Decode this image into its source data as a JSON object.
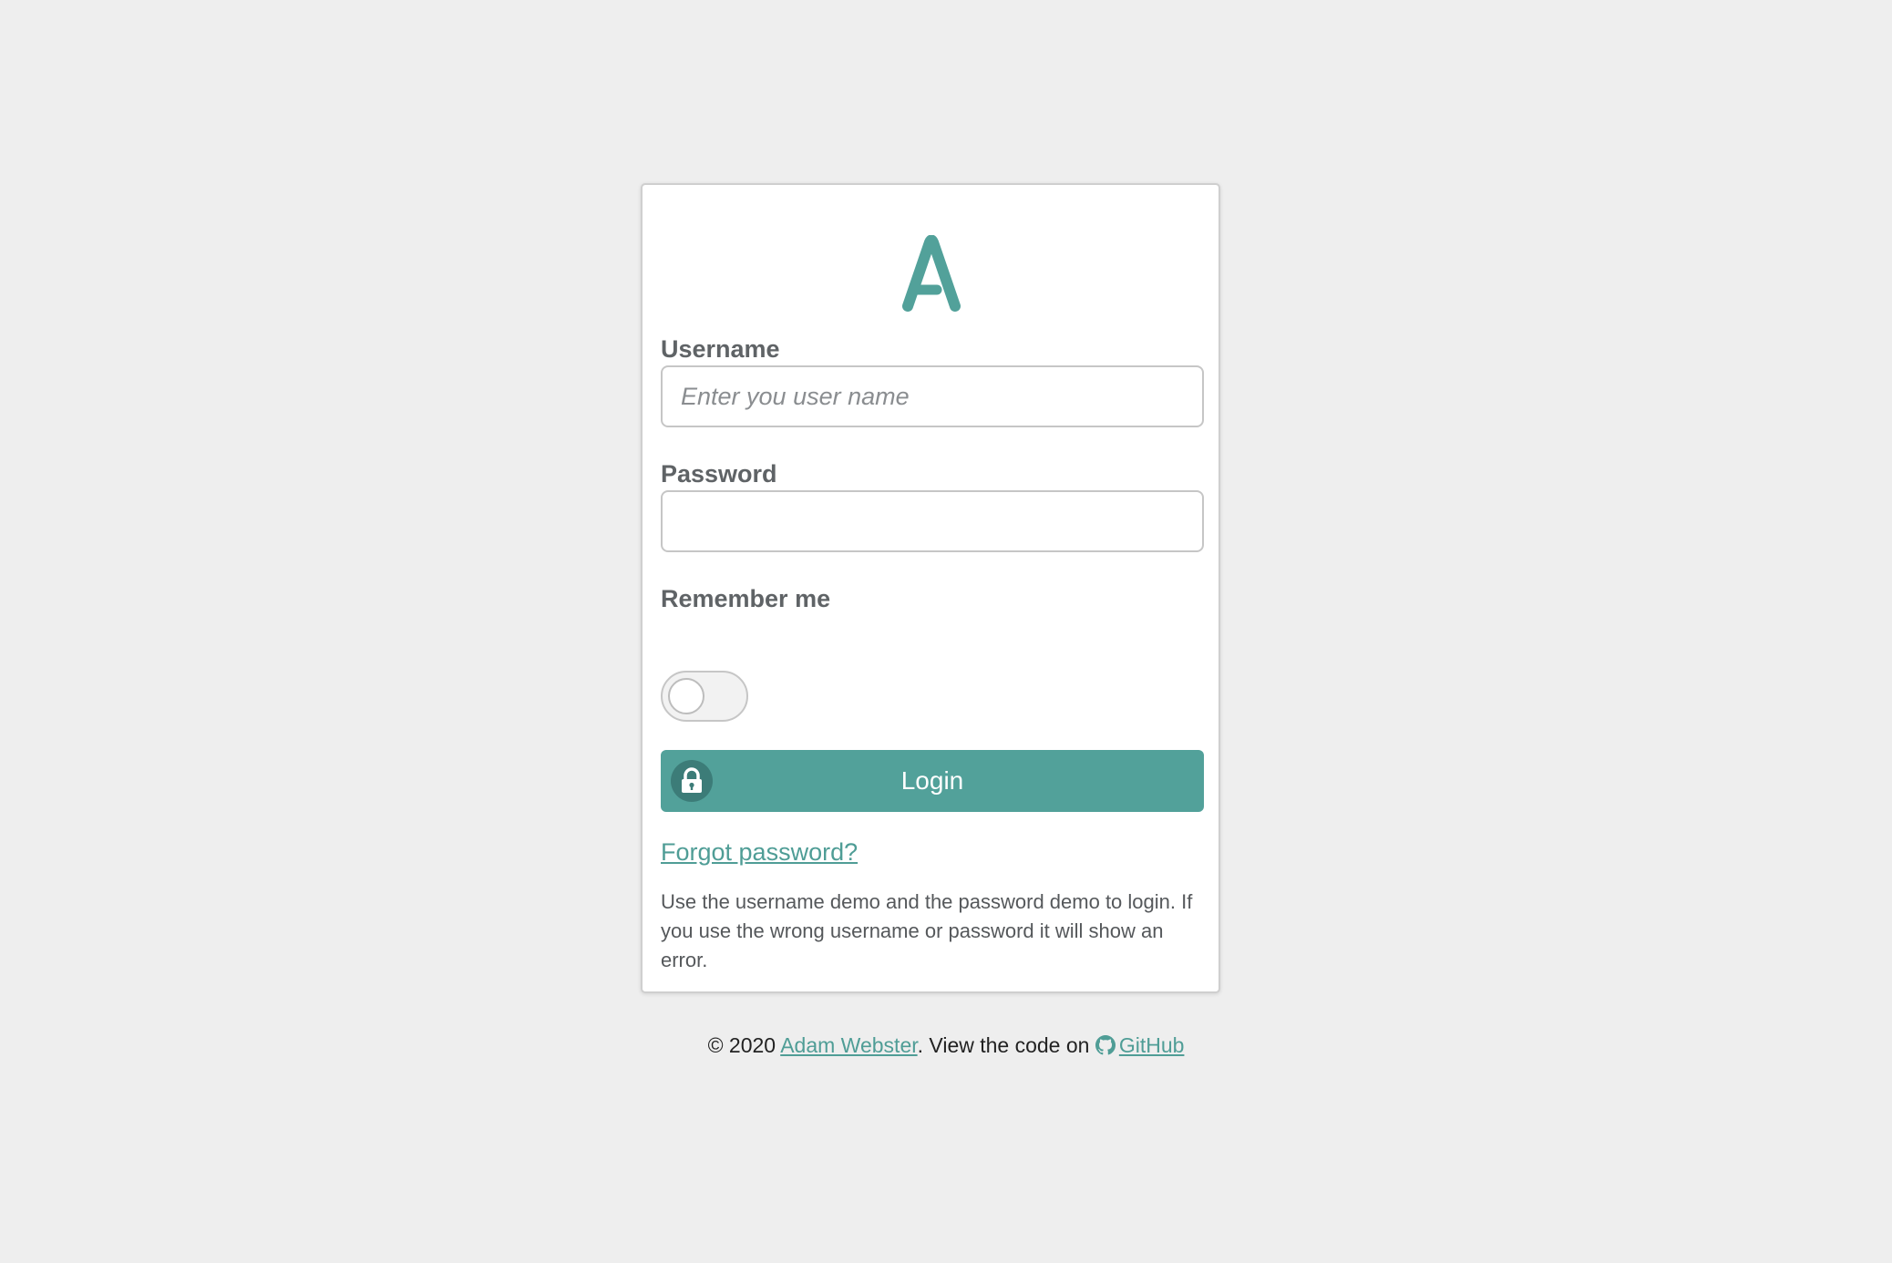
{
  "brand": {
    "logo_letter": "A",
    "accent_color": "#52a19a"
  },
  "form": {
    "username": {
      "label": "Username",
      "placeholder": "Enter you user name",
      "value": ""
    },
    "password": {
      "label": "Password",
      "value": ""
    },
    "remember": {
      "label": "Remember me",
      "checked": false
    },
    "login_button": {
      "label": "Login",
      "icon": "lock-icon"
    },
    "forgot_link": "Forgot password?",
    "hint": "Use the username demo and the password demo to login. If you use the wrong username or password it will show an error."
  },
  "footer": {
    "copyright": "© 2020",
    "author": "Adam Webster",
    "mid_text": ". View the code on",
    "github_icon": "github-icon",
    "github_label": "GitHub"
  }
}
